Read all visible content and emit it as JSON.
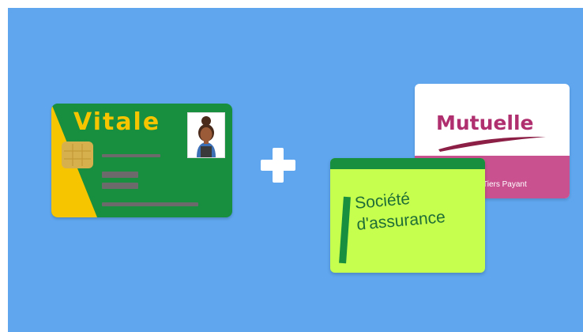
{
  "vitale_card": {
    "title": "Vitale",
    "colors": {
      "card": "#178f3e",
      "wedge": "#f6c500",
      "chip": "#d7b04e",
      "stripes": "#6d6a6c"
    },
    "portrait_icon": "person-portrait-icon"
  },
  "plus_icon": "plus-icon",
  "mutuelle_card": {
    "title": "Mutuelle",
    "band_text": "Tiers Payant",
    "colors": {
      "title": "#b0306f",
      "band": "#c95190",
      "swoosh": "#8c1f45"
    }
  },
  "assurance_card": {
    "line1": "Société",
    "line2": "d'assurance",
    "colors": {
      "card": "#c6ff4d",
      "accent": "#178f3e"
    }
  },
  "background_color": "#5fa6ee"
}
